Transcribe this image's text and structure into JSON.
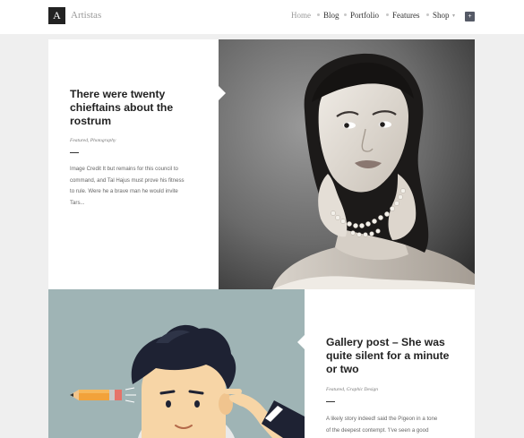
{
  "header": {
    "logo_letter": "A",
    "site_name": "Artistas",
    "nav": [
      {
        "label": "Home",
        "active": true
      },
      {
        "label": "Blog",
        "active": false
      },
      {
        "label": "Portfolio",
        "active": false
      },
      {
        "label": "Features",
        "active": false
      },
      {
        "label": "Shop",
        "active": false
      }
    ],
    "cart_icon": "cart-plus-icon"
  },
  "posts": [
    {
      "title_lines": [
        "There were twenty",
        "chieftains about the",
        "rostrum"
      ],
      "meta": "Featured, Photography",
      "excerpt_lines": [
        "Image Credit It but remains for this council to",
        "command, and Tal Hajus must prove his fitness",
        "to rule. Were he a brave man he would invite",
        "Tars..."
      ],
      "image": "portrait-photo"
    },
    {
      "title_lines": [
        "Gallery post – She was",
        "quite silent for a minute",
        "or two"
      ],
      "meta": "Featured, Graphic Design",
      "excerpt_lines": [
        "A likely story indeed! said the Pigeon in a tone",
        "of the deepest contempt. 'I've seen a good"
      ],
      "image": "cartoon-illustration"
    }
  ],
  "colors": {
    "page_bg": "#efefef",
    "logo_bg": "#222222",
    "illustration_bg": "#9fb4b5",
    "cart_bg": "#555a66"
  }
}
